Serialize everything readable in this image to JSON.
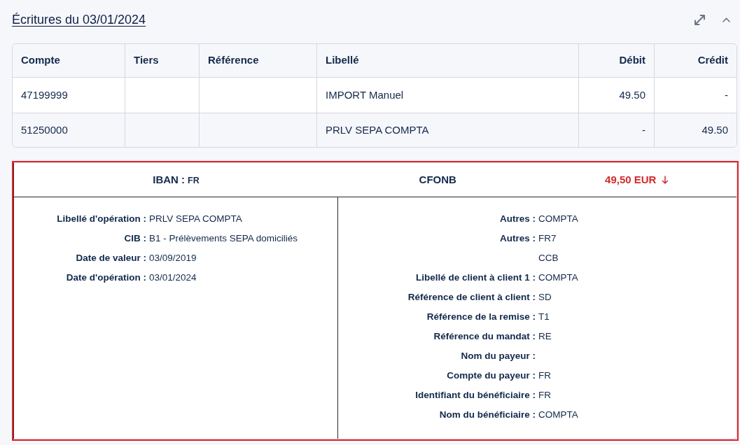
{
  "title": "Écritures du 03/01/2024",
  "table": {
    "columns": [
      {
        "label": "Compte",
        "kind": "text"
      },
      {
        "label": "Tiers",
        "kind": "text"
      },
      {
        "label": "Référence",
        "kind": "text"
      },
      {
        "label": "Libellé",
        "kind": "text"
      },
      {
        "label": "Débit",
        "kind": "amount"
      },
      {
        "label": "Crédit",
        "kind": "amount"
      }
    ],
    "rows": [
      {
        "compte": "47199999",
        "libelle": "IMPORT Manuel",
        "debit": "49.50",
        "credit": "-"
      },
      {
        "compte": "51250000",
        "libelle": "PRLV SEPA COMPTA",
        "debit": "-",
        "credit": "49.50"
      }
    ]
  },
  "detail": {
    "highlighted": true,
    "header": {
      "iban_label": "IBAN :",
      "iban_value": "FR",
      "format": "CFONB",
      "amount": "49,50 EUR",
      "negative": true
    },
    "left_fields": [
      {
        "label": "Libellé d'opération :",
        "values": [
          "PRLV SEPA COMPTA"
        ]
      },
      {
        "label": "CIB :",
        "values": [
          "B1 - Prélèvements SEPA domiciliés"
        ]
      },
      {
        "label": "Date de valeur :",
        "values": [
          "03/09/2019"
        ]
      },
      {
        "label": "Date d'opération :",
        "values": [
          "03/01/2024"
        ]
      }
    ],
    "right_fields": [
      {
        "label": "Autres :",
        "values": [
          "COMPTA"
        ]
      },
      {
        "label": "Autres :",
        "values": [
          "FR7",
          "CCB"
        ]
      },
      {
        "label": "Libellé de client à client 1 :",
        "values": [
          "COMPTA"
        ]
      },
      {
        "label": "Référence de client à client :",
        "values": [
          "SD"
        ]
      },
      {
        "label": "Référence de la remise :",
        "values": [
          "T1"
        ]
      },
      {
        "label": "Référence du mandat :",
        "values": [
          "RE"
        ]
      },
      {
        "label": "Nom du payeur :"
      },
      {
        "label": "Compte du payeur :",
        "values": [
          "FR"
        ]
      },
      {
        "label": "Identifiant du bénéficiaire :",
        "values": [
          "FR"
        ]
      },
      {
        "label": "Nom du bénéficiaire :",
        "values": [
          "COMPTA"
        ]
      }
    ]
  }
}
